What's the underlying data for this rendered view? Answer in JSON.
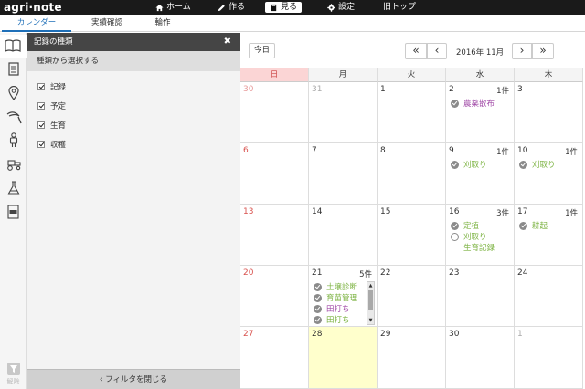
{
  "app": {
    "logo": "agri·note"
  },
  "topnav": [
    {
      "label": "ホーム",
      "icon": "home-icon"
    },
    {
      "label": "作る",
      "icon": "pencil-icon"
    },
    {
      "label": "見る",
      "icon": "book-icon",
      "active": true
    },
    {
      "label": "設定",
      "icon": "gear-icon"
    },
    {
      "label": "旧トップ"
    }
  ],
  "tabs": [
    {
      "label": "カレンダー",
      "active": true
    },
    {
      "label": "実績確認"
    },
    {
      "label": "輪作"
    }
  ],
  "rail": {
    "icons": [
      "book-icon",
      "document-icon",
      "location-pin-icon",
      "sickle-icon",
      "worker-icon",
      "tractor-icon",
      "flask-icon",
      "fertilizer-bag-icon"
    ],
    "filter_release_label": "解除"
  },
  "filter_panel": {
    "title": "記録の種類",
    "subtitle": "種類から選択する",
    "options": [
      {
        "label": "記録",
        "checked": true
      },
      {
        "label": "予定",
        "checked": true
      },
      {
        "label": "生育",
        "checked": true
      },
      {
        "label": "収穫",
        "checked": true
      }
    ],
    "close_label": "フィルタを閉じる"
  },
  "calendar": {
    "today_button": "今日",
    "month_label": "2016年 11月",
    "weekdays": [
      "日",
      "月",
      "火",
      "水",
      "木"
    ],
    "weeks": [
      [
        {
          "day": "30",
          "other": true
        },
        {
          "day": "31",
          "other": true
        },
        {
          "day": "1"
        },
        {
          "day": "2",
          "count": "1件",
          "events": [
            {
              "text": "農薬散布",
              "color": "purple",
              "mark": "check"
            }
          ]
        },
        {
          "day": "3"
        }
      ],
      [
        {
          "day": "6"
        },
        {
          "day": "7"
        },
        {
          "day": "8"
        },
        {
          "day": "9",
          "count": "1件",
          "events": [
            {
              "text": "刈取り",
              "color": "green",
              "mark": "check"
            }
          ]
        },
        {
          "day": "10",
          "count": "1件",
          "events": [
            {
              "text": "刈取り",
              "color": "green",
              "mark": "check"
            }
          ]
        }
      ],
      [
        {
          "day": "13"
        },
        {
          "day": "14"
        },
        {
          "day": "15"
        },
        {
          "day": "16",
          "count": "3件",
          "events": [
            {
              "text": "定植",
              "color": "green",
              "mark": "check"
            },
            {
              "text": "刈取り",
              "color": "green",
              "mark": "circle"
            },
            {
              "text": "生育記録",
              "color": "green",
              "mark": "none"
            }
          ]
        },
        {
          "day": "17",
          "count": "1件",
          "events": [
            {
              "text": "耕起",
              "color": "green",
              "mark": "check"
            }
          ]
        }
      ],
      [
        {
          "day": "20"
        },
        {
          "day": "21",
          "count": "5件",
          "scroll": true,
          "events": [
            {
              "text": "土壌診断",
              "color": "green",
              "mark": "check"
            },
            {
              "text": "育苗管理",
              "color": "green",
              "mark": "check"
            },
            {
              "text": "田打ち",
              "color": "purple",
              "mark": "check"
            },
            {
              "text": "田打ち",
              "color": "green",
              "mark": "check"
            }
          ]
        },
        {
          "day": "22"
        },
        {
          "day": "23"
        },
        {
          "day": "24"
        }
      ],
      [
        {
          "day": "27"
        },
        {
          "day": "28",
          "today": true
        },
        {
          "day": "29"
        },
        {
          "day": "30"
        },
        {
          "day": "1",
          "other": true
        }
      ]
    ],
    "colors": {
      "green": "#7cb342",
      "purple": "#a24ca8",
      "today": "#ffffcc",
      "sunday_header": "#fbd5d5"
    }
  }
}
